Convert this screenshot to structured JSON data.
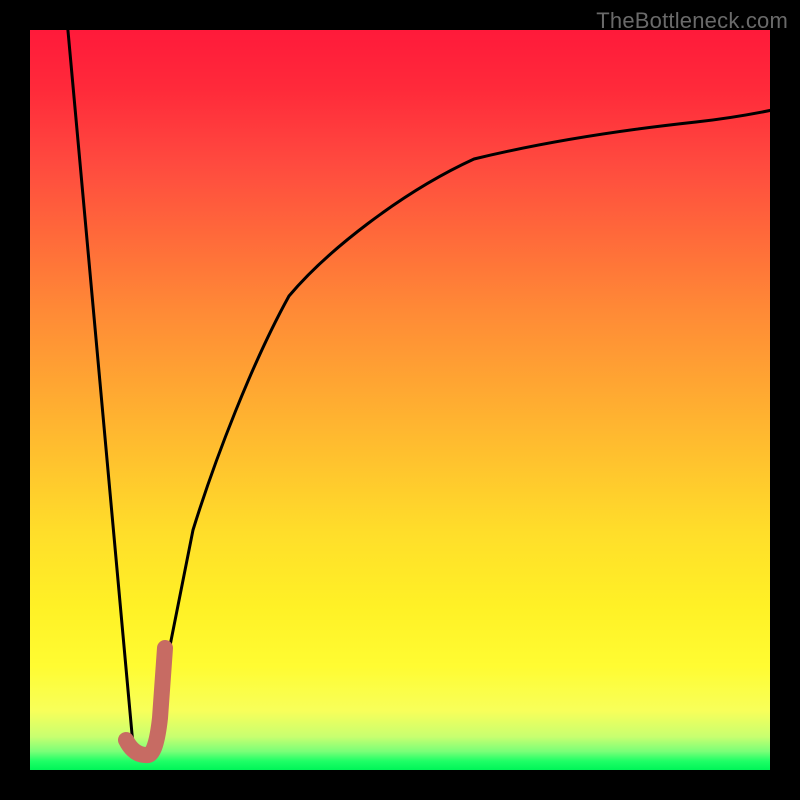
{
  "watermark": "TheBottleneck.com",
  "colors": {
    "black": "#000000",
    "curve_stroke": "#000000",
    "marker_stroke": "#c76b63",
    "gradient_top": "#ff1a3a",
    "gradient_mid": "#ffde2a",
    "gradient_bottom": "#00f558"
  },
  "chart_data": {
    "type": "line",
    "title": "",
    "xlabel": "",
    "ylabel": "",
    "xlim": [
      0,
      100
    ],
    "ylim": [
      0,
      100
    ],
    "grid": false,
    "legend": false,
    "series": [
      {
        "name": "left-descent",
        "x": [
          5,
          14
        ],
        "values": [
          100,
          2
        ],
        "note": "steep linear segment from top-left edge down to valley"
      },
      {
        "name": "right-ascent",
        "x": [
          16,
          18,
          20,
          22,
          25,
          30,
          35,
          40,
          50,
          60,
          70,
          80,
          90,
          100
        ],
        "values": [
          2,
          12,
          22,
          31,
          42,
          55,
          64,
          70,
          78,
          82.5,
          85.5,
          87.5,
          89,
          90
        ],
        "note": "log-like curve rising from valley toward upper right"
      },
      {
        "name": "marker-j",
        "x": [
          13,
          15,
          17,
          18,
          18.2
        ],
        "values": [
          4,
          2,
          2.2,
          7,
          16.5
        ],
        "note": "thick pink J-shaped marker at valley",
        "stroke": "#c76b63",
        "stroke_width_px": 16
      }
    ]
  }
}
